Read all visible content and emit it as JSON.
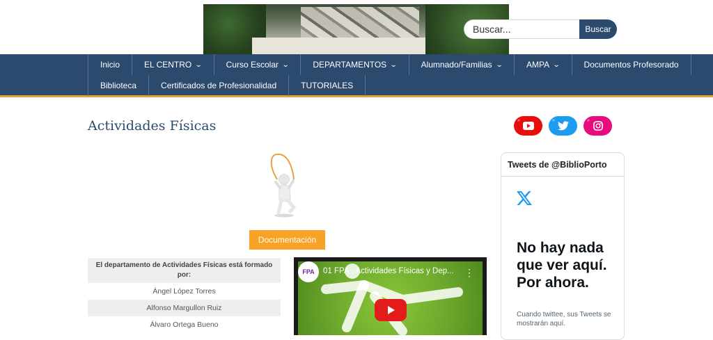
{
  "search": {
    "placeholder": "Buscar...",
    "button_label": "Buscar"
  },
  "nav": {
    "row1": [
      {
        "label": "Inicio",
        "dropdown": false
      },
      {
        "label": "EL CENTRO",
        "dropdown": true
      },
      {
        "label": "Curso Escolar",
        "dropdown": true
      },
      {
        "label": "DEPARTAMENTOS",
        "dropdown": true
      },
      {
        "label": "Alumnado/Familias",
        "dropdown": true
      },
      {
        "label": "AMPA",
        "dropdown": true
      },
      {
        "label": "Documentos Profesorado",
        "dropdown": false
      }
    ],
    "row2": [
      {
        "label": "Biblioteca"
      },
      {
        "label": "Certificados de Profesionalidad"
      },
      {
        "label": "TUTORIALES"
      }
    ]
  },
  "page": {
    "title": "Actividades Físicas"
  },
  "social": [
    "youtube-icon",
    "twitter-icon",
    "instagram-icon"
  ],
  "documentation_button": "Documentación",
  "members": {
    "header": "El departamento de Actividades Físicas está formado por:",
    "names": [
      "Ángel López Torres",
      "Alfonso Margullon Ruiz",
      "Álvaro Ortega Bueno"
    ]
  },
  "video": {
    "title": "01 FPA - Actividades Físicas y Dep...",
    "channel_badge": "FPA"
  },
  "twitter": {
    "header": "Tweets de @BiblioPorto",
    "empty_title": "No hay nada que ver aquí. Por ahora.",
    "empty_text": "Cuando twittee, sus Tweets se mostrarán aquí."
  },
  "colors": {
    "nav_bg": "#2c4a6e",
    "nav_border": "#e3a535",
    "doc_button": "#f7a325"
  }
}
